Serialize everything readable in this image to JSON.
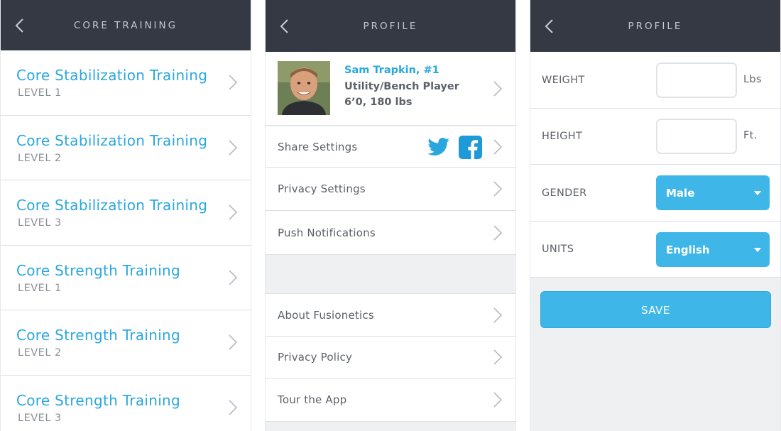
{
  "screens": {
    "core_training": {
      "title": "CORE TRAINING",
      "items": [
        {
          "title": "Core Stabilization Training",
          "level": "LEVEL 1"
        },
        {
          "title": "Core Stabilization Training",
          "level": "LEVEL 2"
        },
        {
          "title": "Core Stabilization Training",
          "level": "LEVEL 3"
        },
        {
          "title": "Core Strength Training",
          "level": "LEVEL 1"
        },
        {
          "title": "Core Strength Training",
          "level": "LEVEL 2"
        },
        {
          "title": "Core Strength Training",
          "level": "LEVEL 3"
        }
      ]
    },
    "profile": {
      "title": "PROFILE",
      "user": {
        "name": "Sam Trapkin, #1",
        "position": "Utility/Bench Player",
        "size": "6’0, 180 lbs"
      },
      "settings": [
        {
          "label": "Share Settings"
        },
        {
          "label": "Privacy Settings"
        },
        {
          "label": "Push Notifications"
        }
      ],
      "info": [
        {
          "label": "About Fusionetics"
        },
        {
          "label": "Privacy Policy"
        },
        {
          "label": "Tour the App"
        }
      ],
      "share_icons": [
        "twitter-icon",
        "facebook-icon"
      ]
    },
    "profile_form": {
      "title": "PROFILE",
      "weight": {
        "label": "WEIGHT",
        "value": "",
        "unit": "Lbs"
      },
      "height": {
        "label": "HEIGHT",
        "value": "",
        "unit": "Ft."
      },
      "gender": {
        "label": "GENDER",
        "selected": "Male"
      },
      "units": {
        "label": "UNITS",
        "selected": "English"
      },
      "save_label": "SAVE"
    }
  },
  "colors": {
    "header_bg": "#353943",
    "accent_blue": "#2aa7df",
    "button_blue": "#3eb7e8",
    "twitter_blue": "#2aa7df",
    "facebook_blue": "#1f9ad8"
  }
}
